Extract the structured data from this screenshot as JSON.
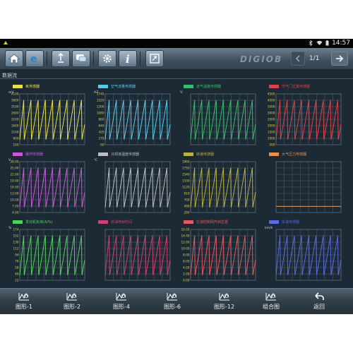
{
  "statusbar": {
    "time": "14:57"
  },
  "toolbar": {
    "buttons": [
      "home-icon",
      "browser-icon",
      "settings-upload-icon",
      "chat-icon",
      "gear-icon",
      "info-icon",
      "exit-icon"
    ],
    "brand": "DIGIOB",
    "page_indicator": "1/1"
  },
  "panel": {
    "title": "数据流"
  },
  "colors": {
    "c1": "#e8e04a",
    "c2": "#5ec8e8",
    "c3": "#3dbb6a",
    "c4": "#e0424a",
    "c5": "#c85ad8",
    "c6": "#bdbdbd",
    "c7": "#b8b040",
    "c8": "#e89050",
    "c9": "#54d060",
    "c10": "#d0406e",
    "c11": "#e05a60",
    "c12": "#5a6ae0"
  },
  "charts": [
    {
      "label": "氧传感器",
      "unit": "mV",
      "ticks": [
        "4100",
        "3600",
        "3100",
        "2600",
        "2100",
        "1600",
        "1100",
        "600",
        "100"
      ]
    },
    {
      "label": "空气流量传感器",
      "unit": "HZ",
      "ticks": [
        "1740",
        "1520",
        "1300",
        "1080",
        "860",
        "640",
        "420",
        "270",
        "60"
      ]
    },
    {
      "label": "进气温度传感器",
      "unit": "℃",
      "ticks": [
        "",
        "",
        "",
        "",
        "",
        "",
        "",
        "",
        ""
      ]
    },
    {
      "label": "节气门位置传感器",
      "unit": "",
      "ticks": [
        "4500",
        "4000",
        "3500",
        "3000",
        "2500",
        "2000",
        "1500",
        "1000",
        "500"
      ]
    },
    {
      "label": "爆炸传感器",
      "unit": "V",
      "ticks": [
        "28.00",
        "25.00",
        "22.00",
        "19.00",
        "16.00",
        "13.00",
        "10.00",
        "7.00",
        "4.00"
      ]
    },
    {
      "label": "冷却液温度传感器",
      "unit": "℃",
      "ticks": [
        "",
        "",
        "",
        "",
        "",
        "",
        "",
        "",
        ""
      ]
    },
    {
      "label": "转速传感器",
      "unit": "",
      "ticks": [
        "1960",
        "1750",
        "1540",
        "1330",
        "1120",
        "910",
        "700",
        "490",
        "280"
      ]
    },
    {
      "label": "大气压力传感器",
      "unit": "",
      "ticks": [
        "",
        "",
        "",
        "",
        "",
        "",
        "",
        "",
        ""
      ]
    },
    {
      "label": "发动机负荷(A/%)",
      "unit": "%",
      "ticks": [
        "174",
        "152",
        "130",
        "112",
        "94",
        "76",
        "58",
        "40",
        "22"
      ]
    },
    {
      "label": "燃油喷射时间",
      "unit": "",
      "ticks": [
        "",
        "",
        "",
        "",
        "",
        "",
        "",
        "",
        ""
      ]
    },
    {
      "label": "怠速控制阀开启位置",
      "unit": "",
      "ticks": [
        "16.00",
        "14.00",
        "12.00",
        "10.00",
        "8.00",
        "6.00",
        "4.00",
        "2.00",
        "0.00"
      ]
    },
    {
      "label": "车速传感器",
      "unit": "km/h",
      "ticks": [
        "",
        "",
        "",
        "",
        "",
        "",
        "",
        "",
        ""
      ]
    }
  ],
  "bottom": [
    {
      "label": "图形-1"
    },
    {
      "label": "图形-2"
    },
    {
      "label": "图形-4"
    },
    {
      "label": "图形-6"
    },
    {
      "label": "图形-12"
    },
    {
      "label": "组合图"
    },
    {
      "label": "返回"
    }
  ]
}
